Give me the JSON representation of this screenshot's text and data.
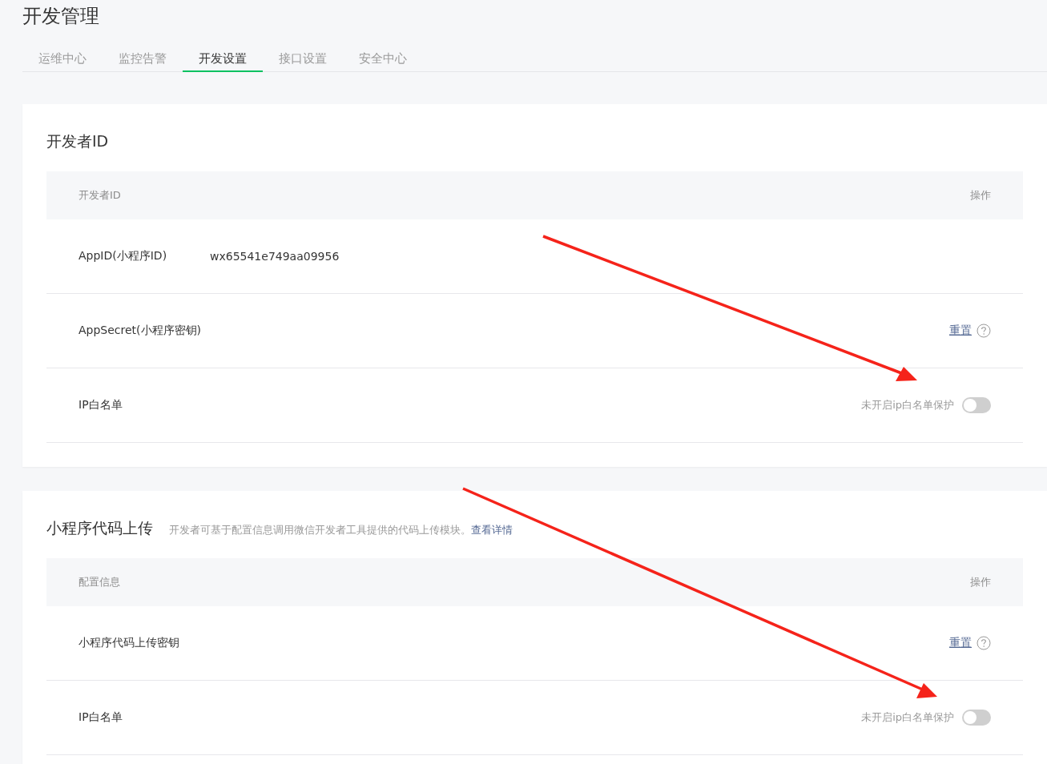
{
  "page_title": "开发管理",
  "tabs": [
    {
      "label": "运维中心",
      "selected": false
    },
    {
      "label": "监控告警",
      "selected": false
    },
    {
      "label": "开发设置",
      "selected": true
    },
    {
      "label": "接口设置",
      "selected": false
    },
    {
      "label": "安全中心",
      "selected": false
    }
  ],
  "sections": [
    {
      "title": "开发者ID",
      "header": {
        "column_1": "开发者ID",
        "action": "操作"
      },
      "rows": [
        {
          "kind": "value",
          "label": "AppID(小程序ID)",
          "value": "wx65541e749aa09956"
        },
        {
          "kind": "reset",
          "label": "AppSecret(小程序密钥)",
          "link": "重置"
        },
        {
          "kind": "toggle",
          "label": "IP白名单",
          "status": "未开启ip白名单保护",
          "on": false
        }
      ]
    },
    {
      "title": "小程序代码上传",
      "description": "开发者可基于配置信息调用微信开发者工具提供的代码上传模块。",
      "link": "查看详情",
      "header": {
        "column_1": "配置信息",
        "action": "操作"
      },
      "rows": [
        {
          "kind": "reset",
          "label": "小程序代码上传密钥",
          "link": "重置"
        },
        {
          "kind": "toggle",
          "label": "IP白名单",
          "status": "未开启ip白名单保护",
          "on": false
        }
      ]
    }
  ]
}
